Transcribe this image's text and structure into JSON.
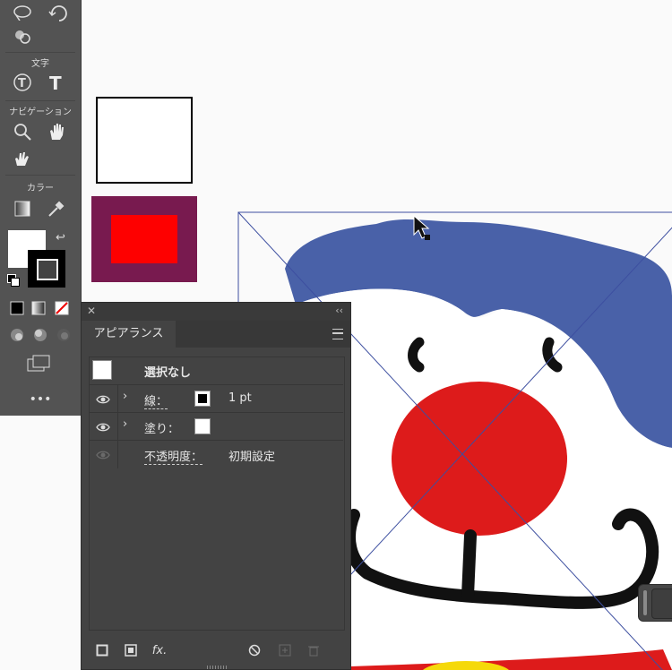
{
  "tools": {
    "sections": {
      "text": "文字",
      "navigation": "ナビゲーション",
      "color": "カラー"
    },
    "more_label": "•••"
  },
  "appearance_panel": {
    "tab_label": "アピアランス",
    "header_label": "選択なし",
    "rows": [
      {
        "label": "線：",
        "value": "1 pt"
      },
      {
        "label": "塗り："
      },
      {
        "label": "不透明度：",
        "value": "初期設定"
      }
    ],
    "footer_fx": "fx."
  },
  "colors": {
    "clown_blue": "#4961a8",
    "nose_red": "#dd1b1b",
    "purple": "#781a4f",
    "red": "#fe0000",
    "guide_line": "#3d4fa0"
  }
}
